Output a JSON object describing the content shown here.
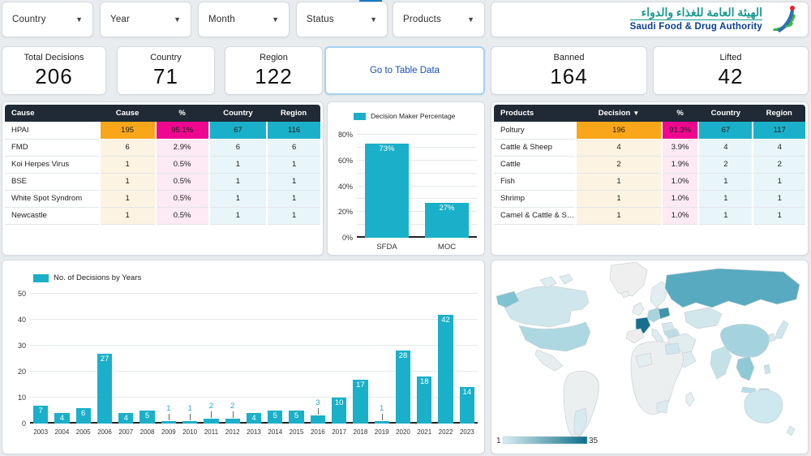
{
  "theme": {
    "accent_teal": "#1bb0c9",
    "orange": "#f9a61a",
    "magenta": "#f00790",
    "header_dark": "#1f2a36",
    "pale_orange": "#fdf3e2",
    "pale_pink": "#fdeaf4",
    "pale_teal": "#e9f6f9",
    "link_blue": "#1b50b8"
  },
  "filters": [
    {
      "label": "Country"
    },
    {
      "label": "Year"
    },
    {
      "label": "Month"
    },
    {
      "label": "Status"
    },
    {
      "label": "Products"
    }
  ],
  "logo": {
    "arabic": "الهيئة العامة للغذاء والدواء",
    "english": "Saudi Food & Drug Authority"
  },
  "kpis_left": [
    {
      "label": "Total Decisions",
      "value": "206"
    },
    {
      "label": "Country",
      "value": "71"
    },
    {
      "label": "Region",
      "value": "122"
    }
  ],
  "nav_button": {
    "label": "Go to Table Data"
  },
  "kpis_right": [
    {
      "label": "Banned",
      "value": "164"
    },
    {
      "label": "Lifted",
      "value": "42"
    }
  ],
  "cause_table": {
    "columns": [
      "Cause",
      "Cause",
      "%",
      "Country",
      "Region"
    ],
    "rows": [
      [
        "HPAI",
        "195",
        "95.1%",
        "67",
        "116"
      ],
      [
        "FMD",
        "6",
        "2.9%",
        "6",
        "6"
      ],
      [
        "Koi Herpes Virus",
        "1",
        "0.5%",
        "1",
        "1"
      ],
      [
        "BSE",
        "1",
        "0.5%",
        "1",
        "1"
      ],
      [
        "White Spot Syndrom",
        "1",
        "0.5%",
        "1",
        "1"
      ],
      [
        "Newcastle",
        "1",
        "0.5%",
        "1",
        "1"
      ]
    ]
  },
  "products_table": {
    "columns": [
      "Products",
      "Decision",
      "%",
      "Country",
      "Region"
    ],
    "sorted_column_index": 1,
    "sort_glyph": "▼",
    "rows": [
      [
        "Poltury",
        "196",
        "91.3%",
        "67",
        "117"
      ],
      [
        "Cattle & Sheep",
        "4",
        "3.9%",
        "4",
        "4"
      ],
      [
        "Cattle",
        "2",
        "1.9%",
        "2",
        "2"
      ],
      [
        "Fish",
        "1",
        "1.0%",
        "1",
        "1"
      ],
      [
        "Shrimp",
        "1",
        "1.0%",
        "1",
        "1"
      ],
      [
        "Camel & Cattle & Sh...",
        "1",
        "1.0%",
        "1",
        "1"
      ]
    ]
  },
  "chart_data": [
    {
      "type": "bar",
      "title": "Decision Maker Percentage",
      "categories": [
        "SFDA",
        "MOC"
      ],
      "values": [
        73,
        27
      ],
      "value_labels": [
        "73%",
        "27%"
      ],
      "ylim": [
        0,
        80
      ],
      "gridline_step": 10,
      "ytick_labels": [
        "0%",
        "20%",
        "40%",
        "60%",
        "80%"
      ],
      "ytick_values": [
        0,
        20,
        40,
        60,
        80
      ],
      "legend_position": "top",
      "bar_color": "#1bb0c9"
    },
    {
      "type": "bar",
      "title": "No. of Decisions by Years",
      "categories": [
        "2003",
        "2004",
        "2005",
        "2006",
        "2007",
        "2008",
        "2009",
        "2010",
        "2011",
        "2012",
        "2013",
        "2014",
        "2015",
        "2016",
        "2017",
        "2018",
        "2019",
        "2020",
        "2021",
        "2022",
        "2023"
      ],
      "values": [
        7,
        4,
        6,
        27,
        4,
        5,
        1,
        1,
        2,
        2,
        4,
        5,
        5,
        3,
        10,
        17,
        1,
        28,
        18,
        42,
        14
      ],
      "ylim": [
        0,
        50
      ],
      "gridline_step": 10,
      "ytick_labels": [
        "0",
        "10",
        "20",
        "30",
        "40",
        "50"
      ],
      "ytick_values": [
        0,
        10,
        20,
        30,
        40,
        50
      ],
      "outside_label_threshold": 3,
      "legend_position": "top-left",
      "bar_color": "#1bb0c9"
    },
    {
      "type": "map",
      "title": "",
      "legend_min": "1",
      "legend_max": "35",
      "palette": [
        "#f0f0f0",
        "#d5e9ee",
        "#abd6df",
        "#7fc0cd",
        "#4ba4ba",
        "#15708d"
      ]
    }
  ]
}
